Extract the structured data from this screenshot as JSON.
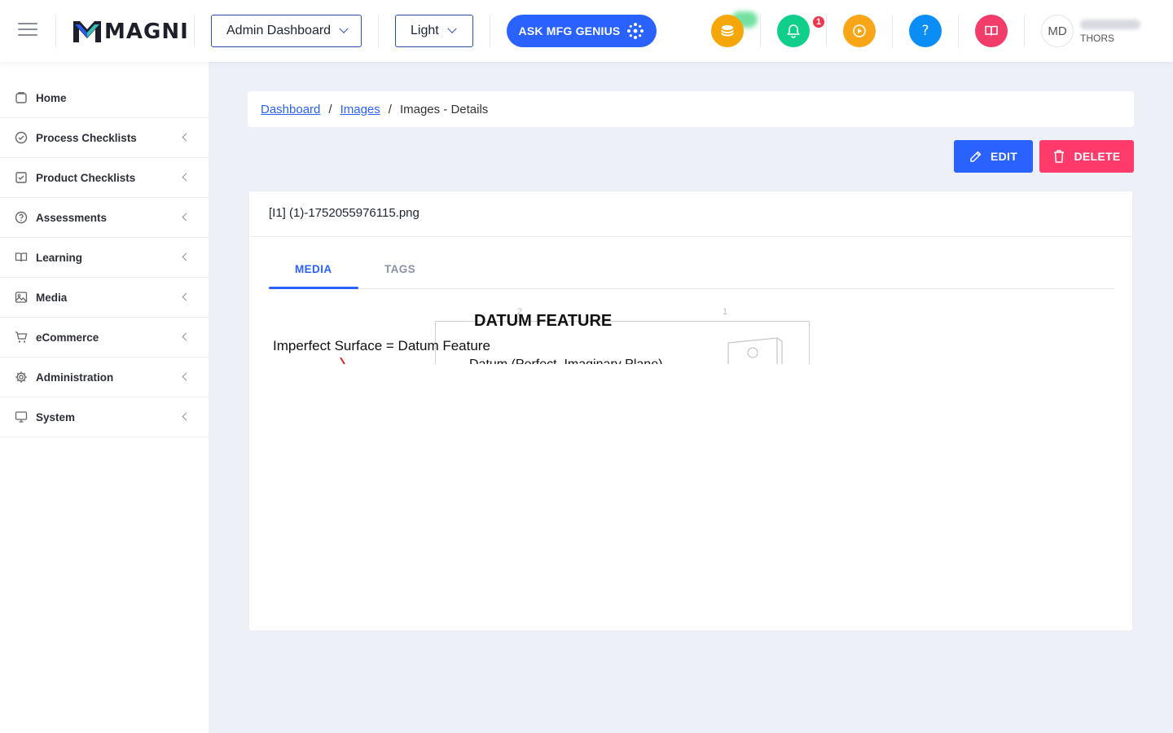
{
  "header": {
    "logo_text": "MAGNI",
    "dashboard_select": "Admin Dashboard",
    "theme_select": "Light",
    "ask_button": "ASK MFG GENIUS",
    "notification_count": "1",
    "avatar_initials": "MD",
    "org_name": "THORS",
    "icons": [
      "coins-icon",
      "bell-icon",
      "play-circle-icon",
      "help-icon",
      "book-icon"
    ],
    "colors": {
      "coins": "#f5a70a",
      "bell": "#0fcf8a",
      "play": "#f8a617",
      "help": "#0a8ef5",
      "book": "#f23d6a",
      "accent": "#2962ff"
    }
  },
  "sidebar": {
    "items": [
      {
        "label": "Home",
        "icon": "home-icon",
        "has_arrow": false
      },
      {
        "label": "Process Checklists",
        "icon": "check-circle-icon",
        "has_arrow": true
      },
      {
        "label": "Product Checklists",
        "icon": "check-square-icon",
        "has_arrow": true
      },
      {
        "label": "Assessments",
        "icon": "help-circle-icon",
        "has_arrow": true
      },
      {
        "label": "Learning",
        "icon": "book-open-icon",
        "has_arrow": true
      },
      {
        "label": "Media",
        "icon": "image-icon",
        "has_arrow": true
      },
      {
        "label": "eCommerce",
        "icon": "cart-icon",
        "has_arrow": true
      },
      {
        "label": "Administration",
        "icon": "gear-icon",
        "has_arrow": true
      },
      {
        "label": "System",
        "icon": "monitor-icon",
        "has_arrow": true
      }
    ]
  },
  "breadcrumb": {
    "items": [
      "Dashboard",
      "Images",
      "Images - Details"
    ],
    "separator": "/"
  },
  "actions": {
    "edit_label": "EDIT",
    "delete_label": "DELETE",
    "edit_color": "#2962ff",
    "delete_color": "#ff3b6b"
  },
  "card": {
    "title": "[I1] (1)-1752055976115.png",
    "tabs": [
      "MEDIA",
      "TAGS"
    ],
    "active_tab": "MEDIA",
    "media": {
      "title": "DATUM FEATURE",
      "line1": "Imperfect Surface = Datum Feature",
      "line2": "Datum (Perfect, Imaginary Plane)",
      "numbers": [
        "2",
        "1"
      ]
    }
  }
}
